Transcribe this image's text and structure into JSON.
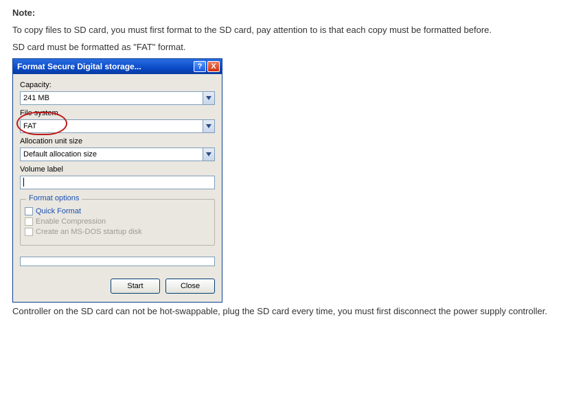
{
  "doc": {
    "note_heading": "Note:",
    "p1": "To copy files to SD card, you must first format to the SD card, pay attention to is that each copy must be formatted before.",
    "p2": "SD card must be formatted as \"FAT\" format.",
    "p3": "Controller on the SD card can not be hot-swappable, plug the SD card every time, you must first disconnect the power supply controller."
  },
  "dialog": {
    "title": "Format Secure Digital storage...",
    "capacity_label": "Capacity:",
    "capacity_value": "241 MB",
    "filesystem_label": "File system",
    "filesystem_value": "FAT",
    "alloc_label": "Allocation unit size",
    "alloc_value": "Default allocation size",
    "volume_label": "Volume label",
    "volume_value": "",
    "groupbox_title": "Format options",
    "opt_quick": "Quick Format",
    "opt_compress": "Enable Compression",
    "opt_msdos": "Create an MS-DOS startup disk",
    "btn_start": "Start",
    "btn_close": "Close"
  }
}
